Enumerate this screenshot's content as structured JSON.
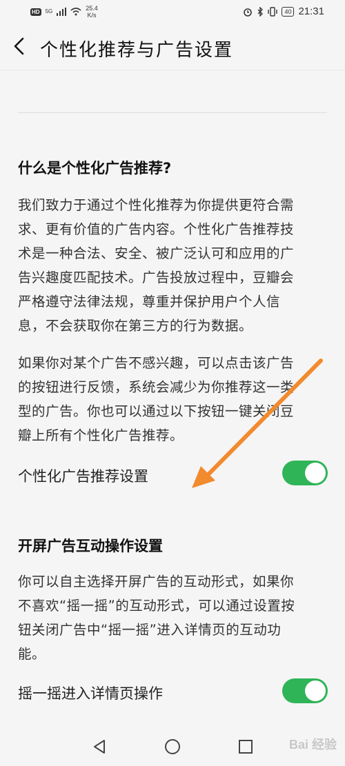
{
  "status_bar": {
    "hd": "HD",
    "signal": "5G",
    "speed_value": "25.4",
    "speed_unit": "K/s",
    "battery": "40",
    "time": "21:31"
  },
  "header": {
    "title": "个性化推荐与广告设置"
  },
  "section1": {
    "title": "什么是个性化广告推荐?",
    "para1_lines": [
      "我们致力于通过个性化推荐为你提供更符合需",
      "求、更有价值的广告内容。个性化广告推荐技",
      "术是一种合法、安全、被广泛认可和应用的广",
      "告兴趣度匹配技术。广告投放过程中，豆瓣会",
      "严格遵守法律法规，尊重并保护用户个人信",
      "息，不会获取你在第三方的行为数据。"
    ],
    "para2_lines": [
      "如果你对某个广告不感兴趣，可以点击该广告",
      "的按钮进行反馈，系统会减少为你推荐这一类",
      "型的广告。你也可以通过以下按钮一键关闭豆",
      "瓣上所有个性化广告推荐。"
    ],
    "setting_label": "个性化广告推荐设置",
    "toggle_on": true
  },
  "section2": {
    "title": "开屏广告互动操作设置",
    "para_lines": [
      "你可以自主选择开屏广告的互动形式，如果你",
      "不喜欢“摇一摇”的互动形式，可以通过设置按",
      "钮关闭广告中“摇一摇”进入详情页的互动功",
      "能。"
    ],
    "setting_label": "摇一摇进入详情页操作",
    "toggle_on": true
  },
  "colors": {
    "toggle_on": "#2fb457",
    "annotation_arrow": "#f28a2e"
  },
  "watermark": "Bai 经验",
  "nav": {
    "icons": [
      "back-triangle-icon",
      "home-circle-icon",
      "recents-square-icon"
    ]
  }
}
